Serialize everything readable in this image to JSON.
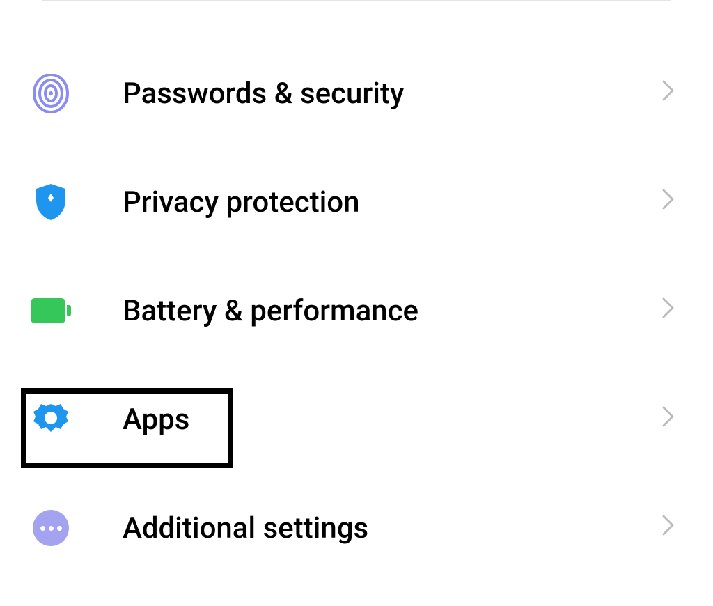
{
  "settings": {
    "items": [
      {
        "key": "passwords-security",
        "label": "Passwords & security",
        "icon": "fingerprint"
      },
      {
        "key": "privacy-protection",
        "label": "Privacy protection",
        "icon": "shield"
      },
      {
        "key": "battery-performance",
        "label": "Battery & performance",
        "icon": "battery"
      },
      {
        "key": "apps",
        "label": "Apps",
        "icon": "gear",
        "highlighted": true
      },
      {
        "key": "additional-settings",
        "label": "Additional settings",
        "icon": "dots"
      }
    ]
  },
  "colors": {
    "fingerprint": "#8b8bf0",
    "shield": "#1e96f0",
    "battery": "#35c759",
    "gear": "#1e96f0",
    "dots": "#a3a3f0",
    "chevron": "#bbbbbb",
    "highlight": "#000000"
  }
}
